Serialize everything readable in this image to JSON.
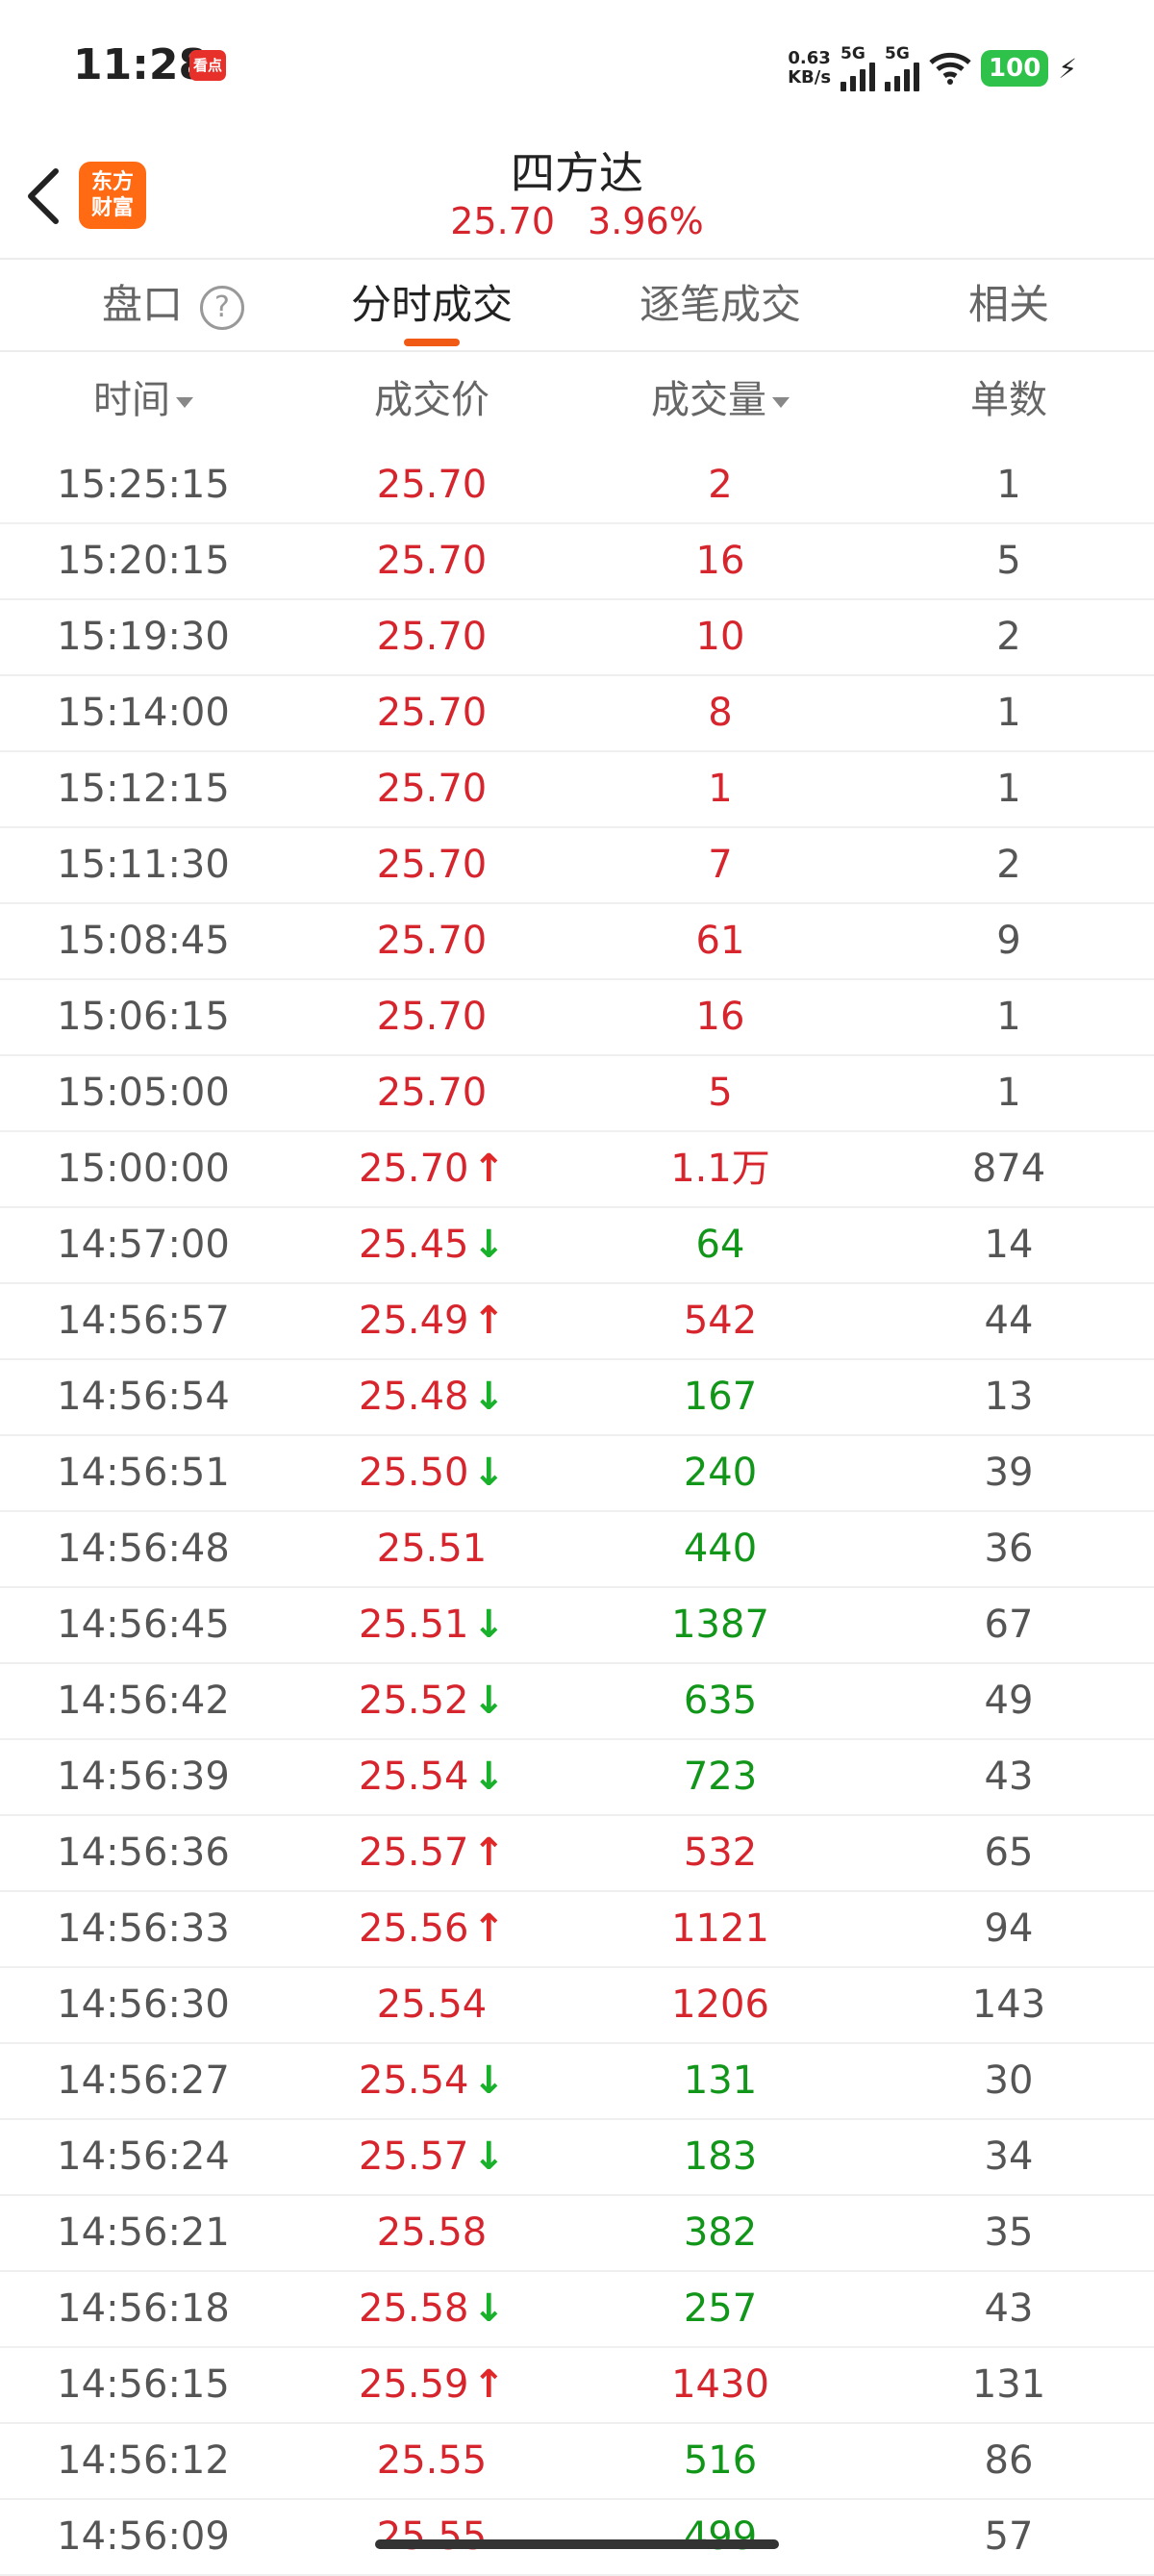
{
  "status_bar": {
    "time": "11:28",
    "app_badge": "看点",
    "net_speed_value": "0.63",
    "net_speed_unit": "KB/s",
    "sim1_label": "5G",
    "sim2_label": "5G",
    "battery": "100",
    "icons": [
      "signal-icon",
      "wifi-icon",
      "battery-icon",
      "charging-icon"
    ]
  },
  "header": {
    "back_icon": "chevron-left-icon",
    "logo_line1": "东方",
    "logo_line2": "财富",
    "title": "四方达",
    "price": "25.70",
    "change_pct": "3.96%"
  },
  "tabs": [
    {
      "label": "盘口",
      "active": false
    },
    {
      "label": "分时成交",
      "active": true
    },
    {
      "label": "逐笔成交",
      "active": false
    },
    {
      "label": "相关",
      "active": false
    }
  ],
  "help_symbol": "?",
  "columns": [
    "时间",
    "成交价",
    "成交量",
    "单数"
  ],
  "rows": [
    {
      "time": "15:25:15",
      "price": "25.70",
      "dir": "",
      "vol": "2",
      "vol_color": "red",
      "count": "1"
    },
    {
      "time": "15:20:15",
      "price": "25.70",
      "dir": "",
      "vol": "16",
      "vol_color": "red",
      "count": "5"
    },
    {
      "time": "15:19:30",
      "price": "25.70",
      "dir": "",
      "vol": "10",
      "vol_color": "red",
      "count": "2"
    },
    {
      "time": "15:14:00",
      "price": "25.70",
      "dir": "",
      "vol": "8",
      "vol_color": "red",
      "count": "1"
    },
    {
      "time": "15:12:15",
      "price": "25.70",
      "dir": "",
      "vol": "1",
      "vol_color": "red",
      "count": "1"
    },
    {
      "time": "15:11:30",
      "price": "25.70",
      "dir": "",
      "vol": "7",
      "vol_color": "red",
      "count": "2"
    },
    {
      "time": "15:08:45",
      "price": "25.70",
      "dir": "",
      "vol": "61",
      "vol_color": "red",
      "count": "9"
    },
    {
      "time": "15:06:15",
      "price": "25.70",
      "dir": "",
      "vol": "16",
      "vol_color": "red",
      "count": "1"
    },
    {
      "time": "15:05:00",
      "price": "25.70",
      "dir": "",
      "vol": "5",
      "vol_color": "red",
      "count": "1"
    },
    {
      "time": "15:00:00",
      "price": "25.70",
      "dir": "up",
      "vol": "1.1万",
      "vol_color": "red",
      "count": "874"
    },
    {
      "time": "14:57:00",
      "price": "25.45",
      "dir": "down",
      "vol": "64",
      "vol_color": "green",
      "count": "14"
    },
    {
      "time": "14:56:57",
      "price": "25.49",
      "dir": "up",
      "vol": "542",
      "vol_color": "red",
      "count": "44"
    },
    {
      "time": "14:56:54",
      "price": "25.48",
      "dir": "down",
      "vol": "167",
      "vol_color": "green",
      "count": "13"
    },
    {
      "time": "14:56:51",
      "price": "25.50",
      "dir": "down",
      "vol": "240",
      "vol_color": "green",
      "count": "39"
    },
    {
      "time": "14:56:48",
      "price": "25.51",
      "dir": "",
      "vol": "440",
      "vol_color": "green",
      "count": "36"
    },
    {
      "time": "14:56:45",
      "price": "25.51",
      "dir": "down",
      "vol": "1387",
      "vol_color": "green",
      "count": "67"
    },
    {
      "time": "14:56:42",
      "price": "25.52",
      "dir": "down",
      "vol": "635",
      "vol_color": "green",
      "count": "49"
    },
    {
      "time": "14:56:39",
      "price": "25.54",
      "dir": "down",
      "vol": "723",
      "vol_color": "green",
      "count": "43"
    },
    {
      "time": "14:56:36",
      "price": "25.57",
      "dir": "up",
      "vol": "532",
      "vol_color": "red",
      "count": "65"
    },
    {
      "time": "14:56:33",
      "price": "25.56",
      "dir": "up",
      "vol": "1121",
      "vol_color": "red",
      "count": "94"
    },
    {
      "time": "14:56:30",
      "price": "25.54",
      "dir": "",
      "vol": "1206",
      "vol_color": "red",
      "count": "143"
    },
    {
      "time": "14:56:27",
      "price": "25.54",
      "dir": "down",
      "vol": "131",
      "vol_color": "green",
      "count": "30"
    },
    {
      "time": "14:56:24",
      "price": "25.57",
      "dir": "down",
      "vol": "183",
      "vol_color": "green",
      "count": "34"
    },
    {
      "time": "14:56:21",
      "price": "25.58",
      "dir": "",
      "vol": "382",
      "vol_color": "green",
      "count": "35"
    },
    {
      "time": "14:56:18",
      "price": "25.58",
      "dir": "down",
      "vol": "257",
      "vol_color": "green",
      "count": "43"
    },
    {
      "time": "14:56:15",
      "price": "25.59",
      "dir": "up",
      "vol": "1430",
      "vol_color": "red",
      "count": "131"
    },
    {
      "time": "14:56:12",
      "price": "25.55",
      "dir": "",
      "vol": "516",
      "vol_color": "green",
      "count": "86"
    },
    {
      "time": "14:56:09",
      "price": "25.55",
      "dir": "",
      "vol": "499",
      "vol_color": "green",
      "count": "57"
    }
  ],
  "colors": {
    "up": "#d6252d",
    "down": "#12961a",
    "accent": "#f05a14"
  }
}
